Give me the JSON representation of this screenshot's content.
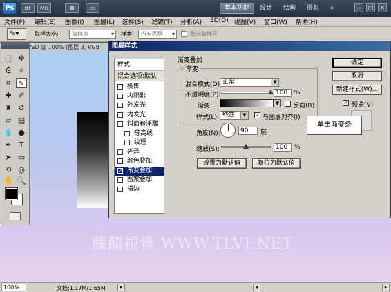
{
  "app": {
    "logo": "Ps",
    "workspaces": [
      "基本功能",
      "设计",
      "绘画",
      "摄影"
    ],
    "window_controls": [
      "—",
      "□",
      "✕"
    ]
  },
  "menu": [
    "文件(F)",
    "编辑(E)",
    "图像(I)",
    "图层(L)",
    "选择(S)",
    "滤镜(T)",
    "分析(A)",
    "3D(D)",
    "视图(V)",
    "窗口(W)",
    "帮助(H)"
  ],
  "options_bar": {
    "sample_size_label": "取样大小:",
    "sample_size_value": "取样点",
    "sample_label": "样本:",
    "sample_value": "所有图层",
    "show_ring_label": "显示取样环"
  },
  "document": {
    "tab_title": "素.PSD @ 100% (图层 3, RGB",
    "watermark": "騰龍視覺 WWW.TLVI.NET"
  },
  "status": {
    "zoom": "100%",
    "doc_info": "文档:1.17M/1.65M"
  },
  "dialog": {
    "title": "图层样式",
    "styles_header": "样式",
    "blending_header": "混合选项:默认",
    "style_items": [
      {
        "label": "投影",
        "checked": false
      },
      {
        "label": "内阴影",
        "checked": false
      },
      {
        "label": "外发光",
        "checked": false
      },
      {
        "label": "内发光",
        "checked": false
      },
      {
        "label": "斜面和浮雕",
        "checked": false
      },
      {
        "label": "等高线",
        "checked": false
      },
      {
        "label": "纹理",
        "checked": false
      },
      {
        "label": "光泽",
        "checked": false
      },
      {
        "label": "颜色叠加",
        "checked": false
      },
      {
        "label": "渐变叠加",
        "checked": true
      },
      {
        "label": "图案叠加",
        "checked": false
      },
      {
        "label": "描边",
        "checked": false
      }
    ],
    "section_title": "渐变叠加",
    "group_title": "渐变",
    "blend_mode_label": "混合模式(O):",
    "blend_mode_value": "正常",
    "opacity_label": "不透明度(P):",
    "opacity_value": "100",
    "opacity_percent": 1.0,
    "gradient_label": "渐变:",
    "reverse_label": "反向(R)",
    "style_label": "样式(L):",
    "style_value": "线性",
    "align_label": "与图层对齐(I)",
    "angle_label": "角度(N):",
    "angle_value": "90",
    "degree_unit": "度",
    "scale_label": "缩放(S):",
    "scale_value": "100",
    "scale_percent": 1.0,
    "percent_unit": "%",
    "set_default_button": "设置为默认值",
    "reset_default_button": "复位为默认值",
    "ok_button": "确定",
    "cancel_button": "取消",
    "new_style_button": "新建样式(W)...",
    "preview_label": "预览(V)"
  },
  "callout": "单击渐变条"
}
